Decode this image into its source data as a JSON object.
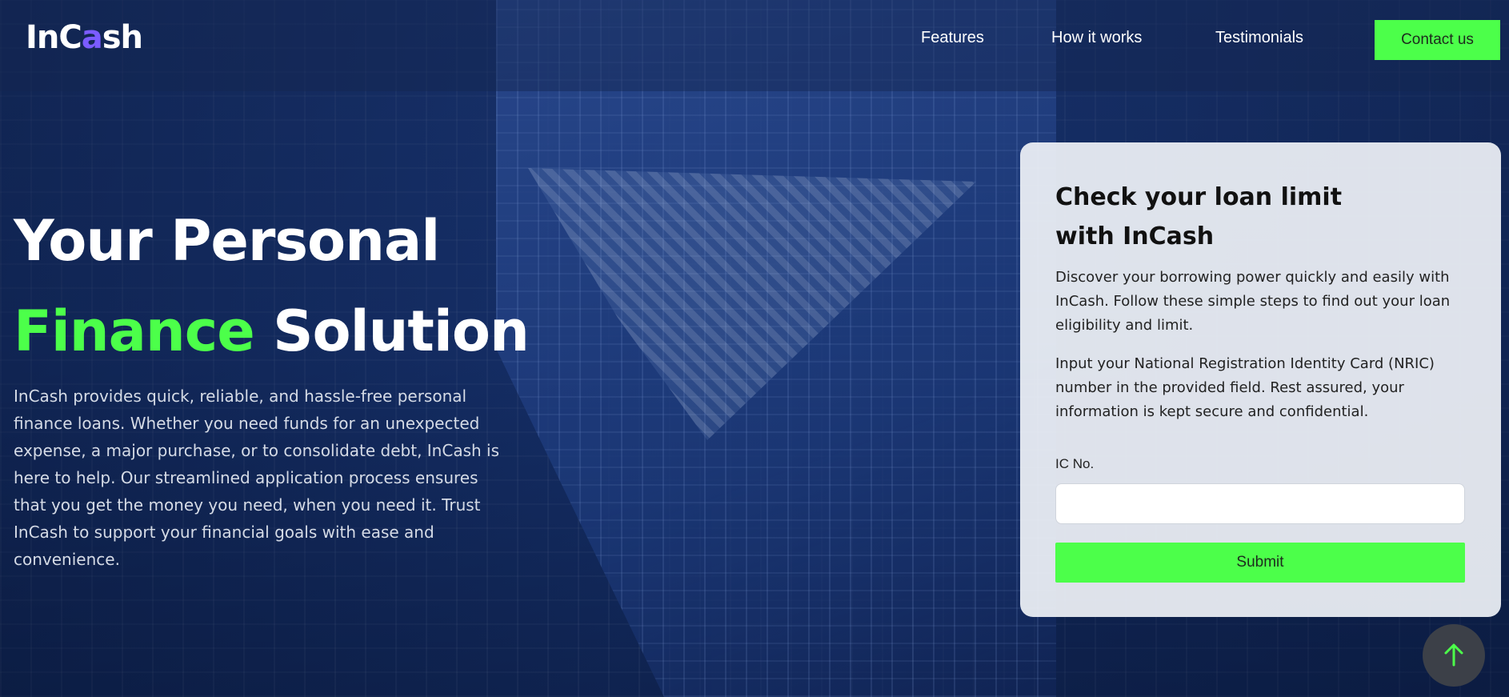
{
  "brand": {
    "logo_part1": "InC",
    "logo_mid": "a",
    "logo_part2": "sh"
  },
  "nav": {
    "links": [
      "Features",
      "How it works",
      "Testimonials"
    ],
    "contact_label": "Contact us"
  },
  "hero": {
    "title_line1": "Your Personal",
    "title_accent": "Finance",
    "title_rest": "Solution",
    "description": "InCash provides quick, reliable, and hassle-free personal finance loans. Whether you need funds for an unexpected expense, a major purchase, or to consolidate debt, InCash is here to help. Our streamlined application process ensures that you get the money you need, when you need it. Trust InCash to support your financial goals with ease and convenience."
  },
  "card": {
    "title": "Check your loan limit with InCash",
    "paragraph1": "Discover your borrowing power quickly and easily with InCash. Follow these simple steps to find out your loan eligibility and limit.",
    "paragraph2": "Input your National Registration Identity Card (NRIC) number in the provided field. Rest assured, your information is kept secure and confidential.",
    "field_label": "IC No.",
    "field_value": "",
    "submit_label": "Submit"
  },
  "scroll_top_icon": "arrow-up-icon",
  "colors": {
    "accent": "#4cff4a",
    "logo_accent": "#7b5cff",
    "card_bg": "#eef1f6"
  }
}
